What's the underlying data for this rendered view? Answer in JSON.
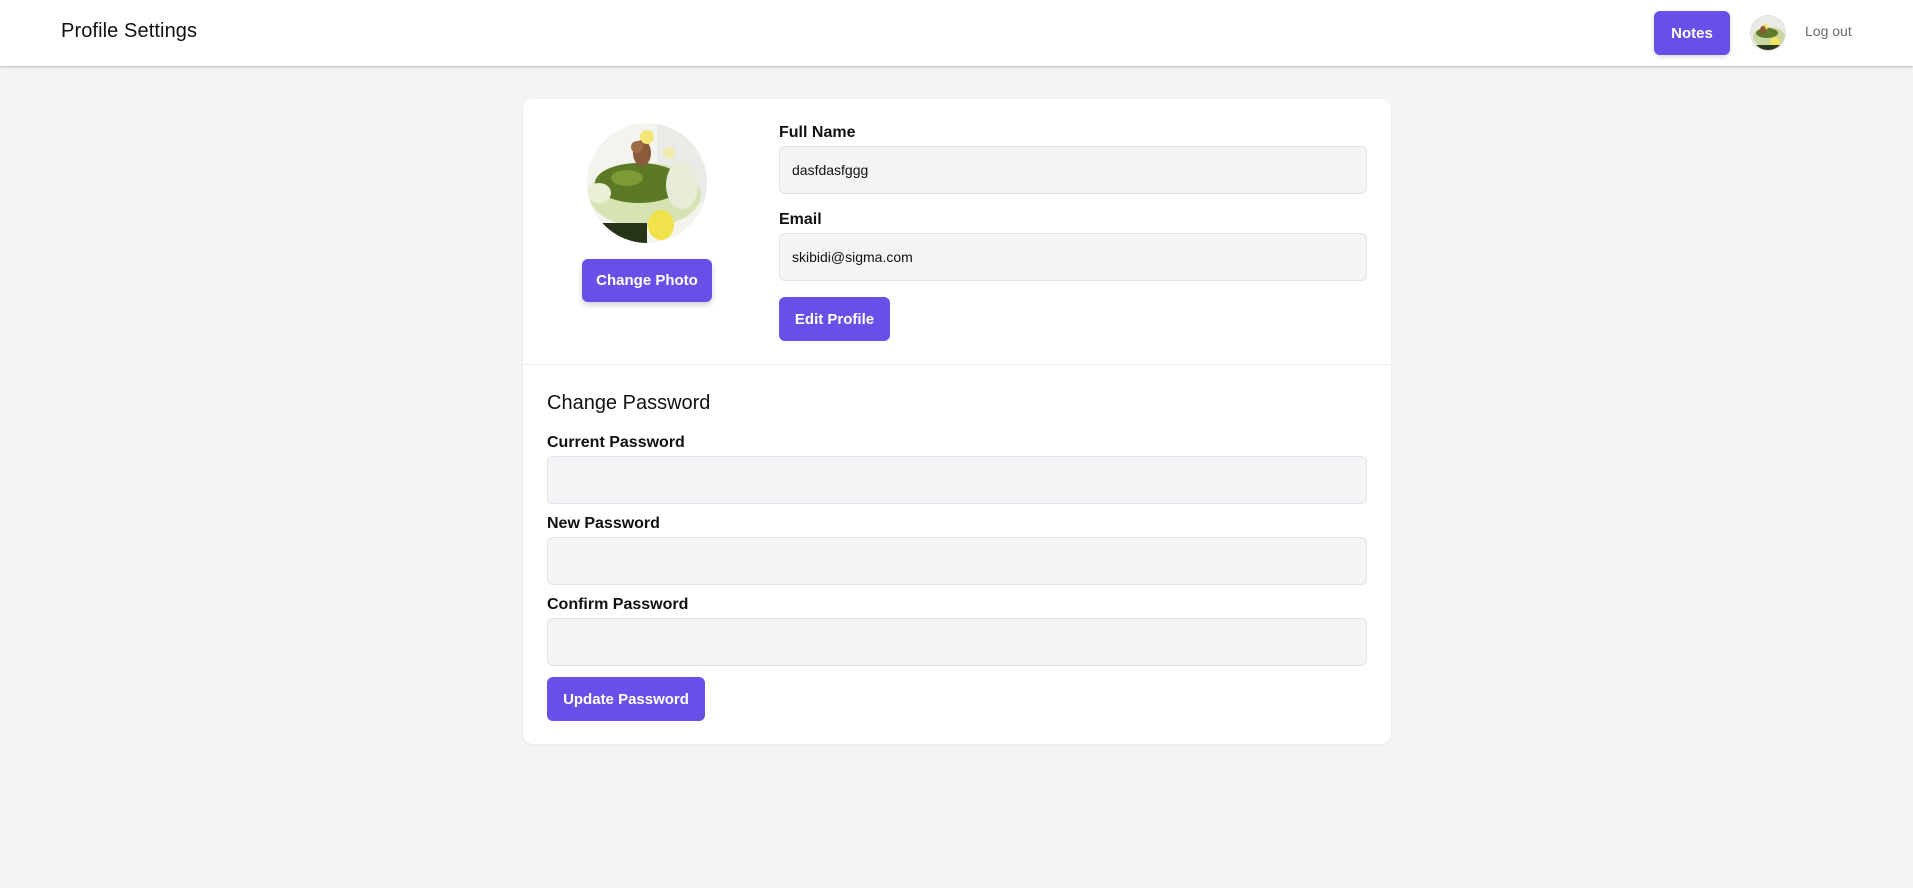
{
  "header": {
    "title": "Profile Settings",
    "notes_label": "Notes",
    "logout_label": "Log out",
    "avatar_icon": "user-avatar-photo"
  },
  "profile": {
    "avatar_icon": "profile-photo",
    "change_photo_label": "Change Photo",
    "full_name_label": "Full Name",
    "full_name_value": "dasfdasfggg",
    "email_label": "Email",
    "email_value": "skibidi@sigma.com",
    "edit_profile_label": "Edit Profile"
  },
  "password": {
    "heading": "Change Password",
    "current_label": "Current Password",
    "current_value": "",
    "new_label": "New Password",
    "new_value": "",
    "confirm_label": "Confirm Password",
    "confirm_value": "",
    "update_label": "Update Password"
  },
  "colors": {
    "accent": "#6750e8",
    "background": "#f3f4f6",
    "card": "#ffffff",
    "input_bg": "#f3f4f6"
  }
}
